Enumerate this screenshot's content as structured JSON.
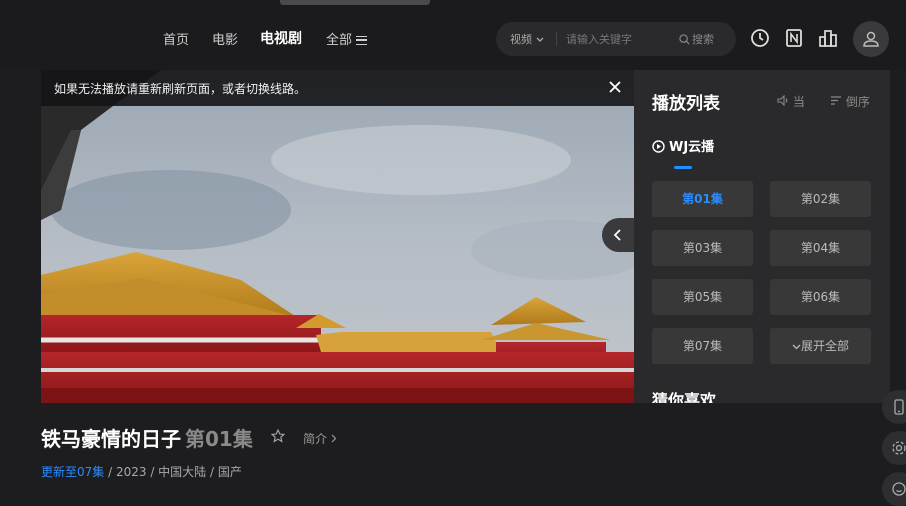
{
  "nav": {
    "home": "首页",
    "movie": "电影",
    "tv": "电视剧",
    "all": "全部"
  },
  "search": {
    "category": "视频",
    "placeholder": "请输入关键字",
    "button": "搜索"
  },
  "header_icons": [
    "clock-icon",
    "bookmark-icon",
    "chart-icon",
    "user-icon"
  ],
  "player": {
    "notice": "如果无法播放请重新刷新页面，或者切换线路。"
  },
  "playlist": {
    "title": "播放列表",
    "action_current": "当",
    "action_reverse": "倒序",
    "source": "WJ云播",
    "episodes": [
      "第01集",
      "第02集",
      "第03集",
      "第04集",
      "第05集",
      "第06集",
      "第07集"
    ],
    "expand_all": "展开全部",
    "guess_title": "猜你喜欢"
  },
  "info": {
    "title": "铁马豪情的日子",
    "episode": "第01集",
    "intro": "简介",
    "update_status": "更新至07集",
    "year": "2023",
    "region": "中国大陆",
    "genre": "国产",
    "separator": " / "
  },
  "colors": {
    "accent": "#2a8cff",
    "background": "#1d1d1f",
    "panel": "#2a2a2c"
  }
}
